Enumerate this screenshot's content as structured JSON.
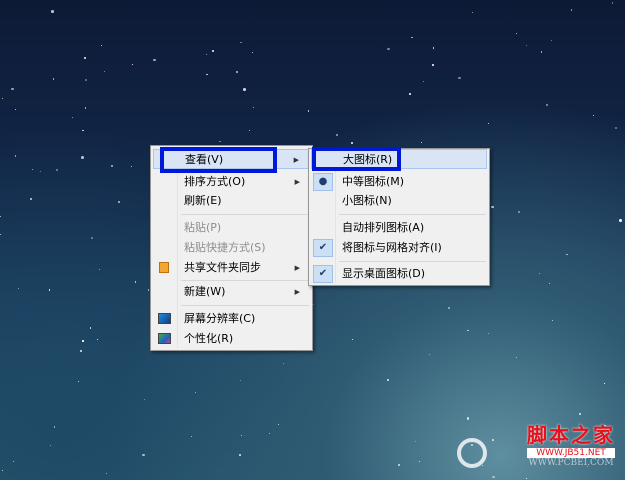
{
  "context_menu": {
    "items": [
      {
        "label": "查看(V)",
        "submenu": true
      },
      {
        "label": "排序方式(O)",
        "submenu": true
      },
      {
        "label": "刷新(E)"
      },
      {
        "label": "粘贴(P)",
        "disabled": true
      },
      {
        "label": "粘贴快捷方式(S)",
        "disabled": true
      },
      {
        "label": "共享文件夹同步",
        "submenu": true,
        "icon": "sync-folder-icon"
      },
      {
        "label": "新建(W)",
        "submenu": true
      },
      {
        "label": "屏幕分辨率(C)",
        "icon": "display-icon"
      },
      {
        "label": "个性化(R)",
        "icon": "personalize-icon"
      }
    ]
  },
  "view_submenu": {
    "items": [
      {
        "label": "大图标(R)"
      },
      {
        "label": "中等图标(M)",
        "selected": true
      },
      {
        "label": "小图标(N)"
      },
      {
        "label": "自动排列图标(A)"
      },
      {
        "label": "将图标与网格对齐(I)",
        "checked": true
      },
      {
        "label": "显示桌面图标(D)",
        "checked": true
      }
    ]
  },
  "watermark": {
    "title": "脚本之家",
    "url": "WWW.JB51.NET",
    "brand": "WWW.PCBEI.COM"
  },
  "colors": {
    "highlight_box": "#0018d8",
    "watermark_red": "#e8101a"
  }
}
